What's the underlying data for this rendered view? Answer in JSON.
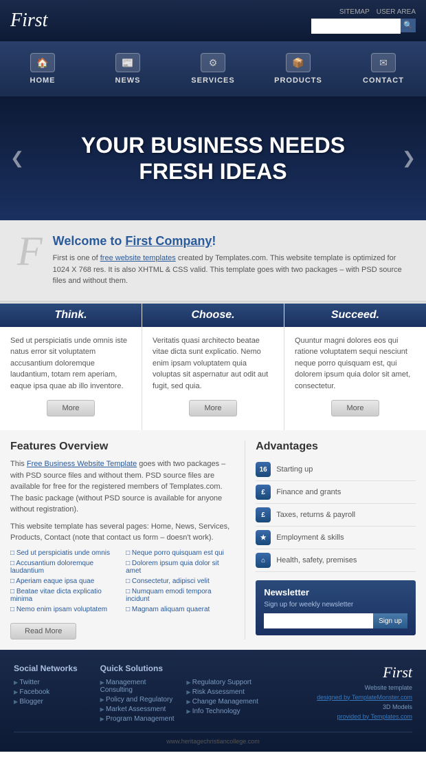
{
  "header": {
    "logo": "First",
    "links": [
      "SITEMAP",
      "USER AREA"
    ],
    "search_placeholder": ""
  },
  "nav": {
    "items": [
      {
        "label": "HOME",
        "icon": "🏠"
      },
      {
        "label": "NEWS",
        "icon": "📰"
      },
      {
        "label": "SERVICES",
        "icon": "⚙"
      },
      {
        "label": "PRODUCTS",
        "icon": "📦"
      },
      {
        "label": "CONTACT",
        "icon": "✉"
      }
    ]
  },
  "hero": {
    "line1": "YOUR BUSINESS NEEDS",
    "line2": "FRESH IDEAS"
  },
  "welcome": {
    "letter": "F",
    "heading_plain": "Welcome to ",
    "heading_colored": "First Company",
    "heading_end": "!",
    "text": "First is one of free website templates created by Templates.com. This website template is optimized for 1024 X 768 res. It is also XHTML & CSS valid. This template goes with two packages – with PSD source files and without them.",
    "link_text": "free website templates"
  },
  "columns": [
    {
      "header": "Think.",
      "text": "Sed ut perspiciatis unde omnis iste natus error sit voluptatem accusantium doloremque laudantium, totam rem aperiam, eaque ipsa quae ab illo inventore.",
      "btn": "More"
    },
    {
      "header": "Choose.",
      "text": "Veritatis quasi architecto beatae vitae dicta sunt explicatio. Nemo enim ipsam voluptatem quia voluptas sit aspernatur aut odit aut fugit, sed quia.",
      "btn": "More"
    },
    {
      "header": "Succeed.",
      "text": "Quuntur magni dolores eos qui ratione voluptatem sequi nesciunt neque porro quisquam est, qui dolorem ipsum quia dolor sit amet, consectetur.",
      "btn": "More"
    }
  ],
  "features": {
    "title": "Features Overview",
    "para1": "This Free Business Website Template goes with two packages – with PSD source files and without them. PSD source files are available for free for the registered members of Templates.com. The basic package (without PSD source is available for anyone without registration).",
    "para2": "This website template has several pages: Home, News, Services, Products, Contact (note that contact us form – doesn't work).",
    "link_text": "Free Business Website Template",
    "list_left": [
      "Sed ut perspiciatis unde omnis",
      "Accusantium doloremque laudantium",
      "Aperiam eaque ipsa quae",
      "Beatae vitae dicta explicatio minima",
      "Nemo enim ipsam voluptatem"
    ],
    "list_right": [
      "Neque porro quisquam est qui",
      "Dolorem ipsum quia dolor sit amet",
      "Consectetur, adipisci velit",
      "Numquam emodi tempora incidunt",
      "Magnam aliquam quaerat"
    ],
    "read_more": "Read More"
  },
  "advantages": {
    "title": "Advantages",
    "items": [
      {
        "icon": "16",
        "label": "Starting up"
      },
      {
        "icon": "£",
        "label": "Finance and grants"
      },
      {
        "icon": "£",
        "label": "Taxes, returns & payroll"
      },
      {
        "icon": "★",
        "label": "Employment & skills"
      },
      {
        "icon": "⌂",
        "label": "Health, safety, premises"
      }
    ]
  },
  "newsletter": {
    "title": "Newsletter",
    "subtitle": "Sign up for weekly newsletter",
    "btn": "Sign up"
  },
  "footer": {
    "col1_title": "Social Networks",
    "col1_links": [
      "Twitter",
      "Facebook",
      "Blogger"
    ],
    "col2_title": "Quick Solutions",
    "col2_links": [
      "Management Consulting",
      "Policy and Regulatory",
      "Market Assessment",
      "Program Management"
    ],
    "col3_title": "",
    "col3_links": [
      "Regulatory Support",
      "Risk Assessment",
      "Change Management",
      "Info Technology"
    ],
    "logo": "First",
    "tagline1": "Website template",
    "tagline2": "designed by TemplateMonster.com",
    "tagline3": "3D Models",
    "tagline4": "provided by Templates.com",
    "watermark": "www.heritagechristiancollege.com"
  }
}
